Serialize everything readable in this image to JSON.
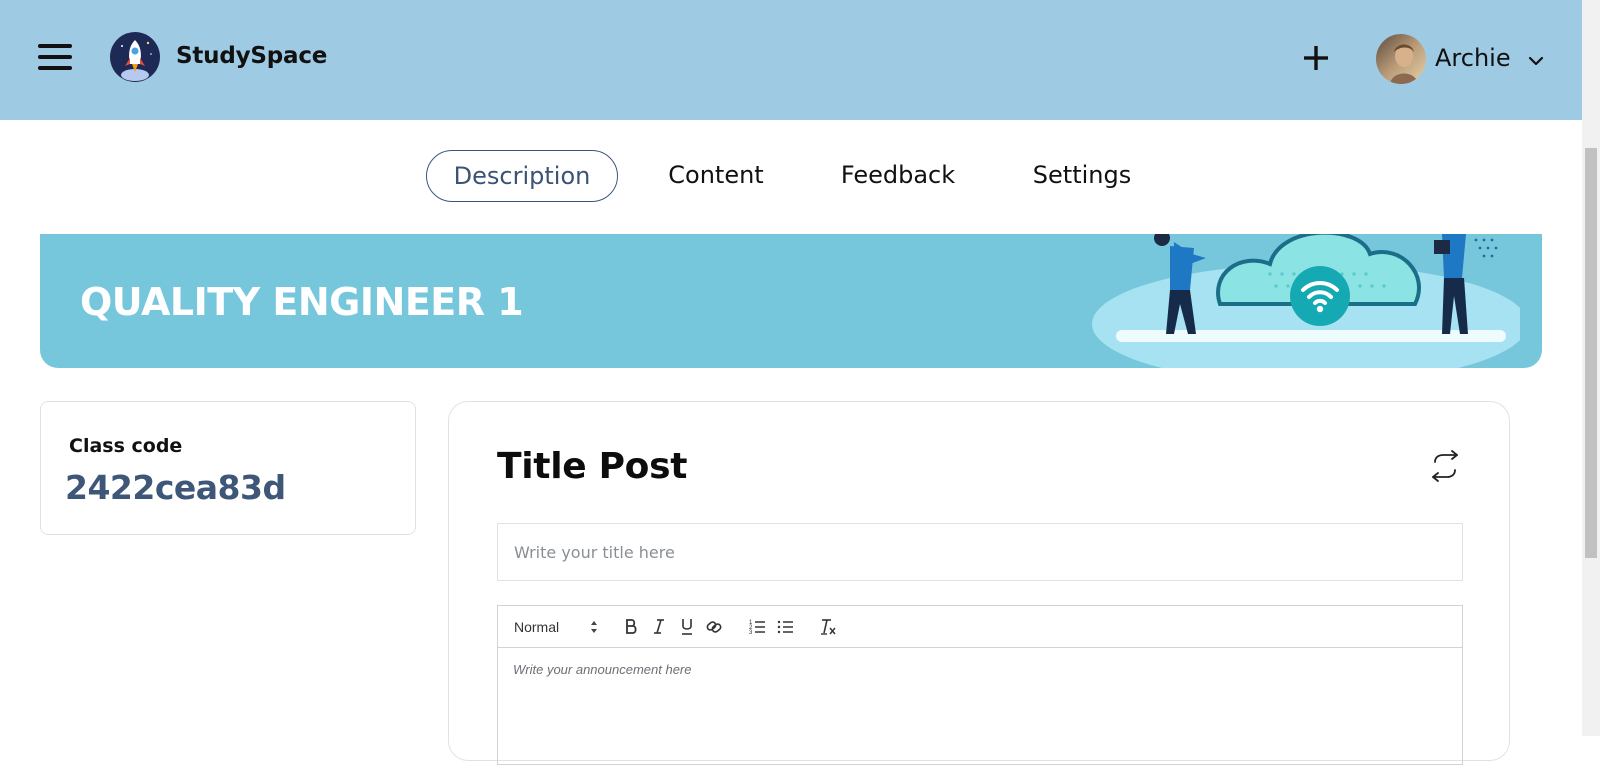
{
  "header": {
    "brand_name": "StudySpace",
    "add_icon": "plus-icon",
    "menu_icon": "hamburger-icon",
    "user": {
      "name": "Archie",
      "dropdown_icon": "chevron-down-icon"
    },
    "background_color": "#9fcae3"
  },
  "tabs": [
    {
      "label": "Description",
      "active": true
    },
    {
      "label": "Content",
      "active": false
    },
    {
      "label": "Feedback",
      "active": false
    },
    {
      "label": "Settings",
      "active": false
    }
  ],
  "banner": {
    "class_name": "QUALITY ENGINEER 1",
    "background_color": "#77c7dc"
  },
  "class_code": {
    "label": "Class code",
    "value": "2422cea83d"
  },
  "post": {
    "heading": "Title Post",
    "swap_icon": "swap-arrows-icon",
    "title_placeholder": "Write your title here",
    "editor": {
      "format_value": "Normal",
      "toolbar_icons": [
        "bold-icon",
        "italic-icon",
        "underline-icon",
        "link-icon",
        "ordered-list-icon",
        "bullet-list-icon",
        "clear-format-icon"
      ],
      "placeholder": "Write your announcement here"
    }
  },
  "accent_color": "#3e5677"
}
